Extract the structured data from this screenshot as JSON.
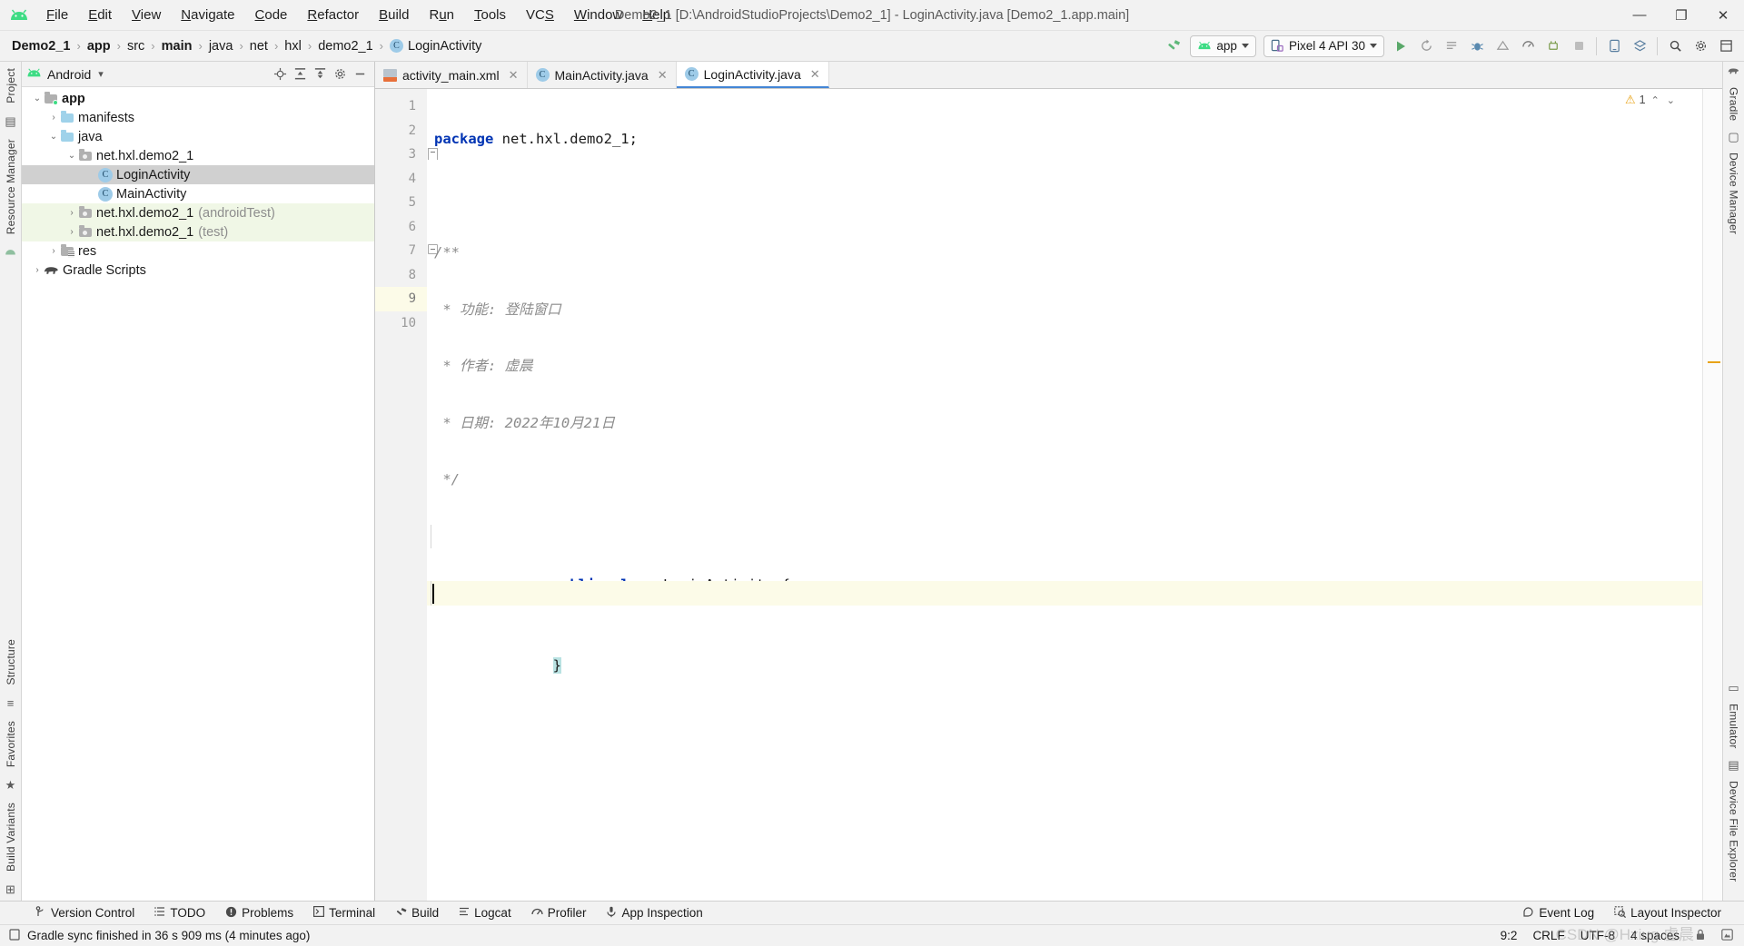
{
  "window": {
    "title": "Demo2_1 [D:\\AndroidStudioProjects\\Demo2_1] - LoginActivity.java [Demo2_1.app.main]",
    "minimize": "—",
    "maximize": "❐",
    "close": "✕"
  },
  "menu": {
    "items": [
      "File",
      "Edit",
      "View",
      "Navigate",
      "Code",
      "Refactor",
      "Build",
      "Run",
      "Tools",
      "VCS",
      "Window",
      "Help"
    ]
  },
  "breadcrumb": {
    "items": [
      "Demo2_1",
      "app",
      "src",
      "main",
      "java",
      "net",
      "hxl",
      "demo2_1"
    ],
    "bold": [
      "Demo2_1",
      "app",
      "main"
    ],
    "last": "LoginActivity",
    "last_icon": "C",
    "separator": "›"
  },
  "toolbar": {
    "build_icon": "build-hammer-icon",
    "run_config": "app",
    "device": "Pixel 4 API 30",
    "run_icon": "▶",
    "icons": [
      "rerun-icon",
      "apply-changes-icon",
      "debug-icon",
      "apply-code-changes-icon",
      "profile-icon",
      "attach-debugger-icon",
      "stop-icon",
      "avd-manager-icon",
      "sdk-manager-icon",
      "search-icon",
      "settings-gear-icon",
      "layout-inspector-icon"
    ]
  },
  "left_rail": {
    "top": [
      "Project"
    ],
    "middle": [
      "Resource Manager"
    ],
    "bottom": [
      "Structure",
      "Favorites"
    ],
    "bottom_extra": [
      "Build Variants"
    ]
  },
  "right_rail": {
    "items": [
      "Gradle",
      "Device Manager",
      "Emulator",
      "Device File Explorer"
    ]
  },
  "project_panel": {
    "title": "Android",
    "dropdown_caret": "▾",
    "head_icons": [
      "target-locate-icon",
      "expand-all-icon",
      "collapse-all-icon",
      "settings-gear-icon",
      "hide-icon"
    ],
    "tree": [
      {
        "label": "app",
        "indent": 0,
        "arrow": "⌄",
        "icon": "folder-module",
        "bold": true,
        "suffix": "",
        "state": "normal"
      },
      {
        "label": "manifests",
        "indent": 1,
        "arrow": "›",
        "icon": "folder-blue",
        "bold": false,
        "suffix": "",
        "state": "normal"
      },
      {
        "label": "java",
        "indent": 1,
        "arrow": "⌄",
        "icon": "folder-blue",
        "bold": false,
        "suffix": "",
        "state": "normal"
      },
      {
        "label": "net.hxl.demo2_1",
        "indent": 2,
        "arrow": "⌄",
        "icon": "folder-package",
        "bold": false,
        "suffix": "",
        "state": "normal"
      },
      {
        "label": "LoginActivity",
        "indent": 3,
        "arrow": "",
        "icon": "class-icon",
        "bold": false,
        "suffix": "",
        "state": "selected"
      },
      {
        "label": "MainActivity",
        "indent": 3,
        "arrow": "",
        "icon": "class-icon",
        "bold": false,
        "suffix": "",
        "state": "normal"
      },
      {
        "label": "net.hxl.demo2_1",
        "indent": 2,
        "arrow": "›",
        "icon": "folder-package",
        "bold": false,
        "suffix": "(androidTest)",
        "state": "test"
      },
      {
        "label": "net.hxl.demo2_1",
        "indent": 2,
        "arrow": "›",
        "icon": "folder-package",
        "bold": false,
        "suffix": "(test)",
        "state": "test"
      },
      {
        "label": "res",
        "indent": 1,
        "arrow": "›",
        "icon": "folder-res",
        "bold": false,
        "suffix": "",
        "state": "normal"
      },
      {
        "label": "Gradle Scripts",
        "indent": 0,
        "arrow": "›",
        "icon": "gradle-icon",
        "bold": false,
        "suffix": "",
        "state": "normal"
      }
    ]
  },
  "editor": {
    "tabs": [
      {
        "label": "activity_main.xml",
        "icon": "xml-file-icon",
        "active": false,
        "close": "✕"
      },
      {
        "label": "MainActivity.java",
        "icon": "java-class-icon",
        "active": false,
        "close": "✕"
      },
      {
        "label": "LoginActivity.java",
        "icon": "java-class-icon",
        "active": true,
        "close": "✕"
      }
    ],
    "inspection": {
      "count": "1",
      "warn_glyph": "⚠",
      "up": "⌃",
      "down": "⌄"
    },
    "line_numbers": [
      "1",
      "2",
      "3",
      "4",
      "5",
      "6",
      "7",
      "8",
      "9",
      "10"
    ],
    "current_line": 9,
    "code_lines": [
      {
        "n": 1,
        "tokens": [
          {
            "t": "package ",
            "c": "kw"
          },
          {
            "t": "net.hxl.demo2_1;",
            "c": "pl"
          }
        ]
      },
      {
        "n": 2,
        "tokens": []
      },
      {
        "n": 3,
        "tokens": [
          {
            "t": "/**",
            "c": "cmt"
          }
        ]
      },
      {
        "n": 4,
        "tokens": [
          {
            "t": " * 功能: 登陆窗口",
            "c": "cmt"
          }
        ]
      },
      {
        "n": 5,
        "tokens": [
          {
            "t": " * 作者: 虚晨",
            "c": "cmt"
          }
        ]
      },
      {
        "n": 6,
        "tokens": [
          {
            "t": " * 日期: 2022年10月21日",
            "c": "cmt"
          }
        ]
      },
      {
        "n": 7,
        "tokens": [
          {
            "t": " */",
            "c": "cmt"
          }
        ]
      },
      {
        "n": 8,
        "tokens": [
          {
            "t": "public class ",
            "c": "kw"
          },
          {
            "t": "LoginActivity",
            "c": "ty"
          },
          {
            "t": " {",
            "c": "pl"
          }
        ]
      },
      {
        "n": 9,
        "tokens": [
          {
            "t": "}",
            "c": "sel-brace"
          }
        ]
      },
      {
        "n": 10,
        "tokens": []
      }
    ]
  },
  "tool_windows": {
    "items": [
      {
        "label": "Version Control",
        "icon": "branch-icon"
      },
      {
        "label": "TODO",
        "icon": "list-icon"
      },
      {
        "label": "Problems",
        "icon": "exclamation-circle-icon"
      },
      {
        "label": "Terminal",
        "icon": "terminal-icon"
      },
      {
        "label": "Build",
        "icon": "hammer-icon"
      },
      {
        "label": "Logcat",
        "icon": "logcat-icon"
      },
      {
        "label": "Profiler",
        "icon": "profiler-icon"
      },
      {
        "label": "App Inspection",
        "icon": "inspection-icon"
      }
    ],
    "right": [
      {
        "label": "Event Log",
        "icon": "event-log-icon"
      },
      {
        "label": "Layout Inspector",
        "icon": "layout-inspector-icon"
      }
    ]
  },
  "status_bar": {
    "message": "Gradle sync finished in 36 s 909 ms (4 minutes ago)",
    "message_icon": "memory-icon",
    "caret_position": "9:2",
    "line_separator": "CRLF",
    "encoding": "UTF-8",
    "indent": "4 spaces",
    "lock_icon": "lock-icon",
    "notify_icon": "notification-icon"
  },
  "watermark": "CSDN @Hxiug 虚晨",
  "colors": {
    "accent_blue": "#4386d6",
    "keyword": "#0033b3",
    "comment": "#8c8c8c",
    "android_green": "#3ddc84",
    "selection": "#d0d0d0",
    "test_scope": "#f0f7e6",
    "current_line": "#fcfbe8",
    "warn": "#e8a317"
  }
}
